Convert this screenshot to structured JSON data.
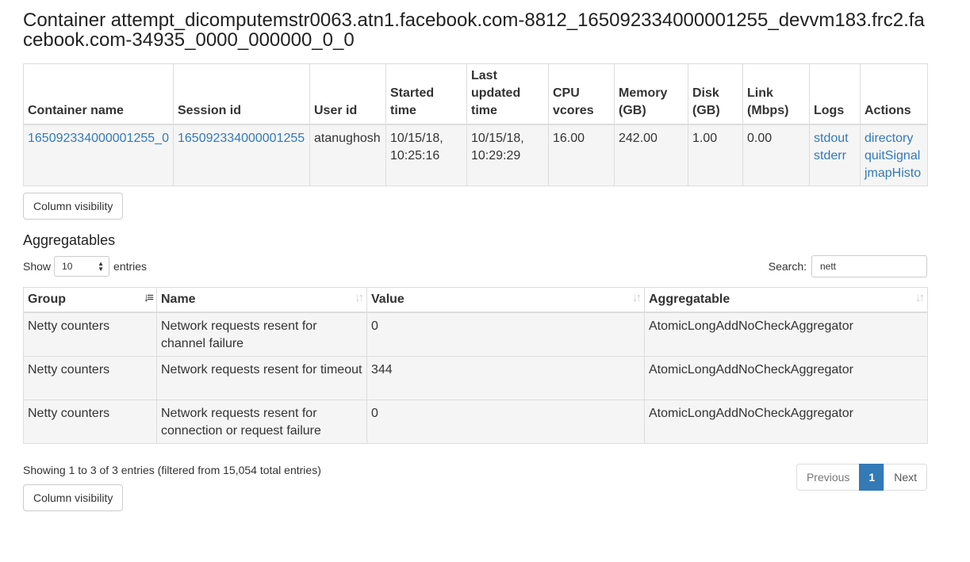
{
  "page_title": "Container attempt_dicomputemstr0063.atn1.facebook.com-8812_165092334000001255_devvm183.frc2.facebook.com-34935_0000_000000_0_0",
  "container_table": {
    "headers": [
      "Container name",
      "Session id",
      "User id",
      "Started time",
      "Last updated time",
      "CPU vcores",
      "Memory (GB)",
      "Disk (GB)",
      "Link (Mbps)",
      "Logs",
      "Actions"
    ],
    "row": {
      "container_name": "165092334000001255_0",
      "session_id": "165092334000001255",
      "user_id": "atanughosh",
      "started_time": "10/15/18, 10:25:16",
      "last_updated_time": "10/15/18, 10:29:29",
      "cpu_vcores": "16.00",
      "memory_gb": "242.00",
      "disk_gb": "1.00",
      "link_mbps": "0.00",
      "logs": [
        "stdout",
        "stderr"
      ],
      "actions": [
        "directory",
        "quitSignal",
        "jmapHisto"
      ]
    }
  },
  "column_visibility_label": "Column visibility",
  "aggregatables": {
    "heading": "Aggregatables",
    "show_label": "Show",
    "entries_label": "entries",
    "page_size": "10",
    "search_label": "Search:",
    "search_value": "nett",
    "headers": [
      "Group",
      "Name",
      "Value",
      "Aggregatable"
    ],
    "rows": [
      {
        "group": "Netty counters",
        "name": "Network requests resent for channel failure",
        "value": "0",
        "aggregatable": "AtomicLongAddNoCheckAggregator"
      },
      {
        "group": "Netty counters",
        "name": "Network requests resent for timeout",
        "value": "344",
        "aggregatable": "AtomicLongAddNoCheckAggregator"
      },
      {
        "group": "Netty counters",
        "name": "Network requests resent for connection or request failure",
        "value": "0",
        "aggregatable": "AtomicLongAddNoCheckAggregator"
      }
    ],
    "info": "Showing 1 to 3 of 3 entries (filtered from 15,054 total entries)",
    "pagination": {
      "previous": "Previous",
      "current": "1",
      "next": "Next"
    }
  },
  "icons": {
    "sort_active": "sort-asc-icon",
    "sort_inactive": "sort-both-icon",
    "select_arrows": "updown-arrows-icon"
  }
}
